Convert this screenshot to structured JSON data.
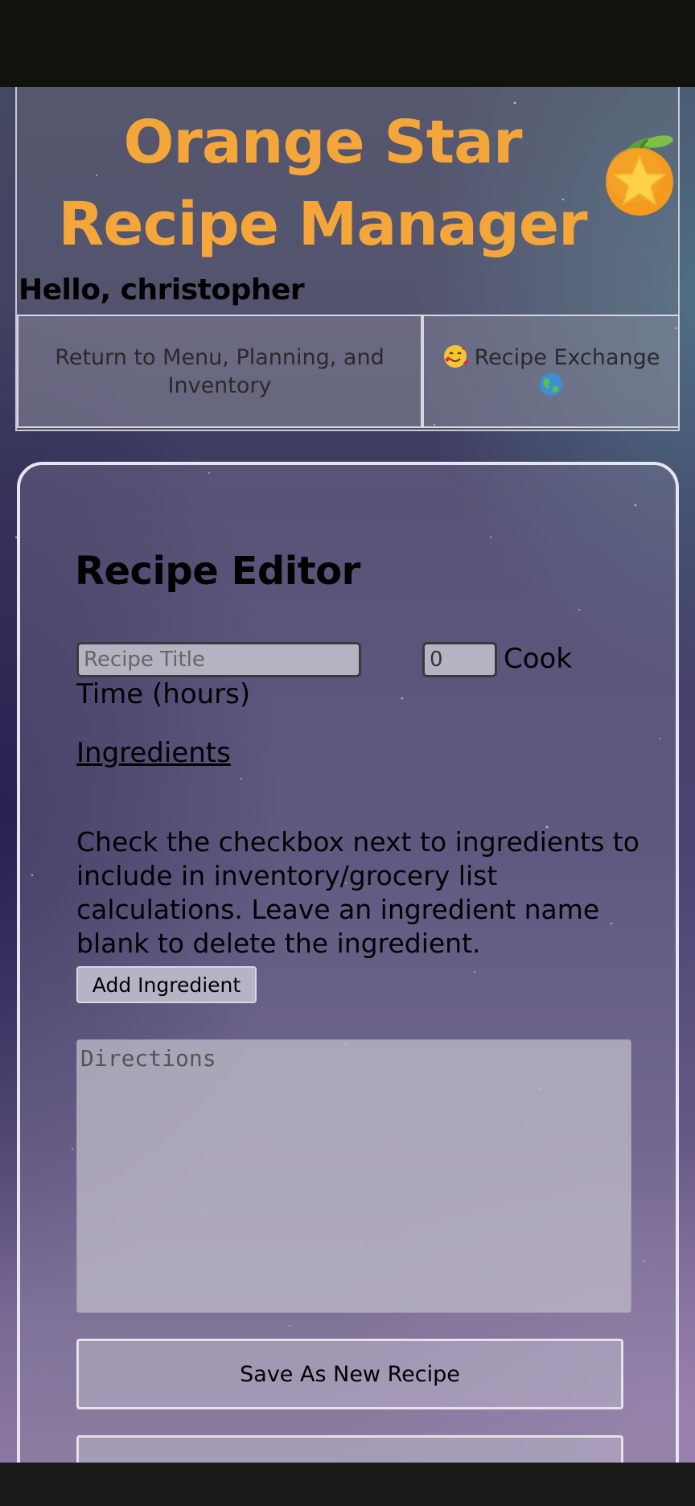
{
  "header": {
    "app_title": "Orange Star Recipe Manager",
    "logo_icon": "orange-star-icon",
    "greeting": "Hello, christopher",
    "nav": {
      "menu_label": "Return to Menu, Planning, and Inventory",
      "exchange_label": "Recipe Exchange",
      "exchange_icons": [
        "smiling-face-with-hearts-icon",
        "globe-icon"
      ]
    }
  },
  "editor": {
    "title": "Recipe Editor",
    "recipe_title_placeholder": "Recipe Title",
    "cook_time_value": "0",
    "cook_time_label_part1": "Cook",
    "cook_time_label_part2": "Time (hours)",
    "ingredients_link": "Ingredients",
    "instructions": "Check the checkbox next to ingredients to include in inventory/grocery list calculations. Leave an ingredient name blank to delete the ingredient.",
    "add_ingredient_label": "Add Ingredient",
    "directions_placeholder": "Directions",
    "save_new_label": "Save As New Recipe"
  },
  "colors": {
    "title_orange": "#f4a63a",
    "status_bar": "#11120e"
  }
}
